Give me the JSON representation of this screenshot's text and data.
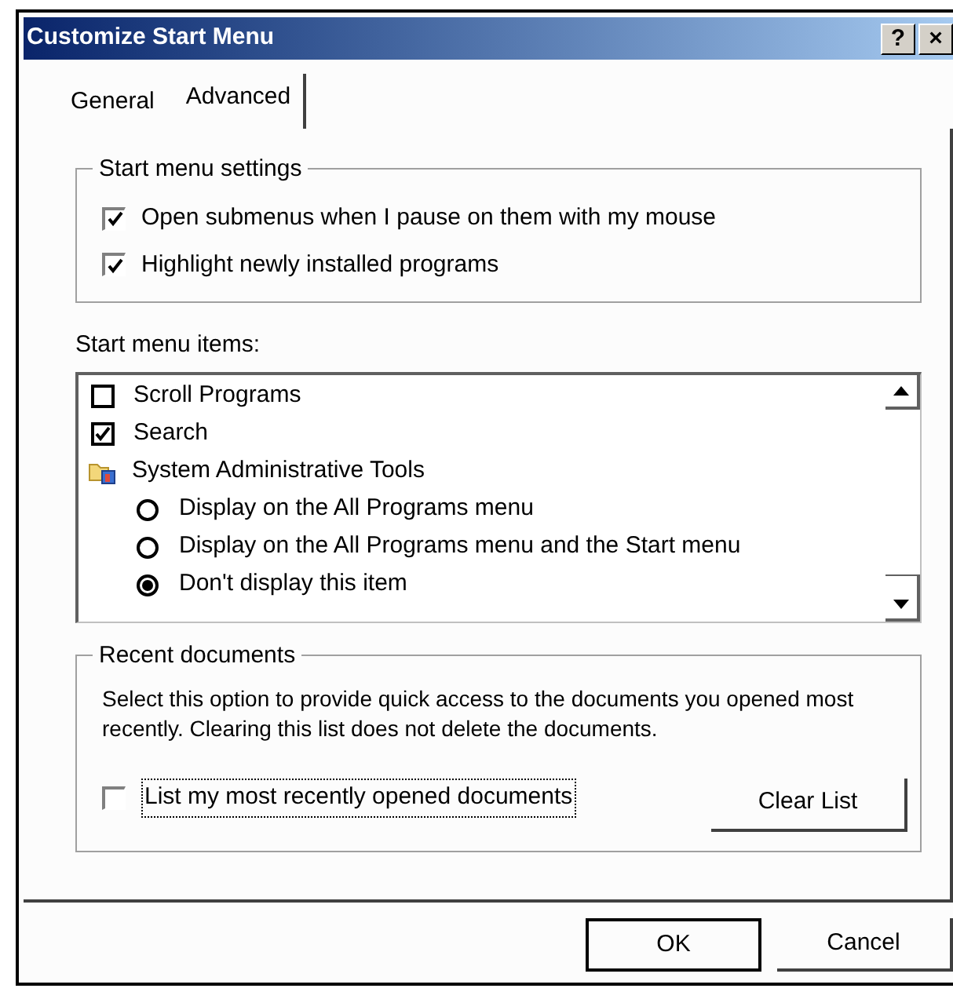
{
  "window": {
    "title": "Customize Start Menu",
    "title_buttons": [
      "?",
      "×"
    ]
  },
  "tabs": [
    {
      "label": "General",
      "selected": false
    },
    {
      "label": "Advanced",
      "selected": true
    }
  ],
  "start_menu_settings": {
    "title": "Start menu settings",
    "options": [
      {
        "label": "Open submenus when I pause on them with my mouse",
        "checked": true
      },
      {
        "label": "Highlight newly installed programs",
        "checked": true
      }
    ]
  },
  "start_menu_items": {
    "label": "Start menu items:",
    "items": [
      {
        "kind": "checkbox",
        "label": "Scroll Programs",
        "checked": false
      },
      {
        "kind": "checkbox",
        "label": "Search",
        "checked": true
      },
      {
        "kind": "folder",
        "label": "System Administrative Tools",
        "children": [
          {
            "kind": "radio",
            "label": "Display on the All Programs menu",
            "selected": false
          },
          {
            "kind": "radio",
            "label": "Display on the All Programs menu and the Start menu",
            "selected": false
          },
          {
            "kind": "radio",
            "label": "Don't display this item",
            "selected": true
          }
        ]
      }
    ]
  },
  "recent_documents": {
    "title": "Recent documents",
    "description": "Select this option to provide quick access to the documents you opened most recently.  Clearing this list does not delete the documents.",
    "option": {
      "label": "List my most recently opened documents",
      "checked": false
    },
    "button": "Clear List"
  },
  "buttons": [
    "OK",
    "Cancel"
  ]
}
